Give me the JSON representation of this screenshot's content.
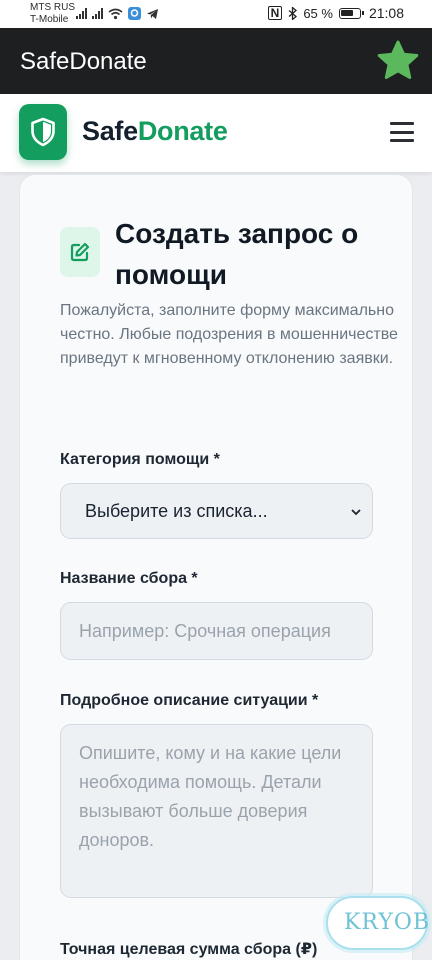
{
  "status_bar": {
    "carrier_line1": "MTS RUS",
    "carrier_line2": "T-Mobile",
    "nfc": "N",
    "battery": "65 %",
    "time": "21:08"
  },
  "app_bar": {
    "title": "SafeDonate",
    "star_color": "#5cb85c"
  },
  "header": {
    "brand_part1": "Safe",
    "brand_part2": "Donate",
    "brand_color": "#139d5e"
  },
  "form": {
    "title": "Создать запрос о помощи",
    "intro": "Пожалуйста, заполните форму максимально честно. Любые подозрения в мошенничестве приведут к мгновенному отклонению заявки.",
    "category": {
      "label": "Категория помощи *",
      "selected": "Выберите из списка..."
    },
    "name": {
      "label": "Название сбора *",
      "placeholder": "Например: Срочная операция"
    },
    "description": {
      "label": "Подробное описание ситуации *",
      "placeholder": "Опишите, кому и на какие цели необходима помощь. Детали вызывают больше доверия доноров."
    },
    "amount": {
      "label": "Точная целевая сумма сбора (₽)"
    }
  },
  "watermark": {
    "text": "KRYOB"
  }
}
